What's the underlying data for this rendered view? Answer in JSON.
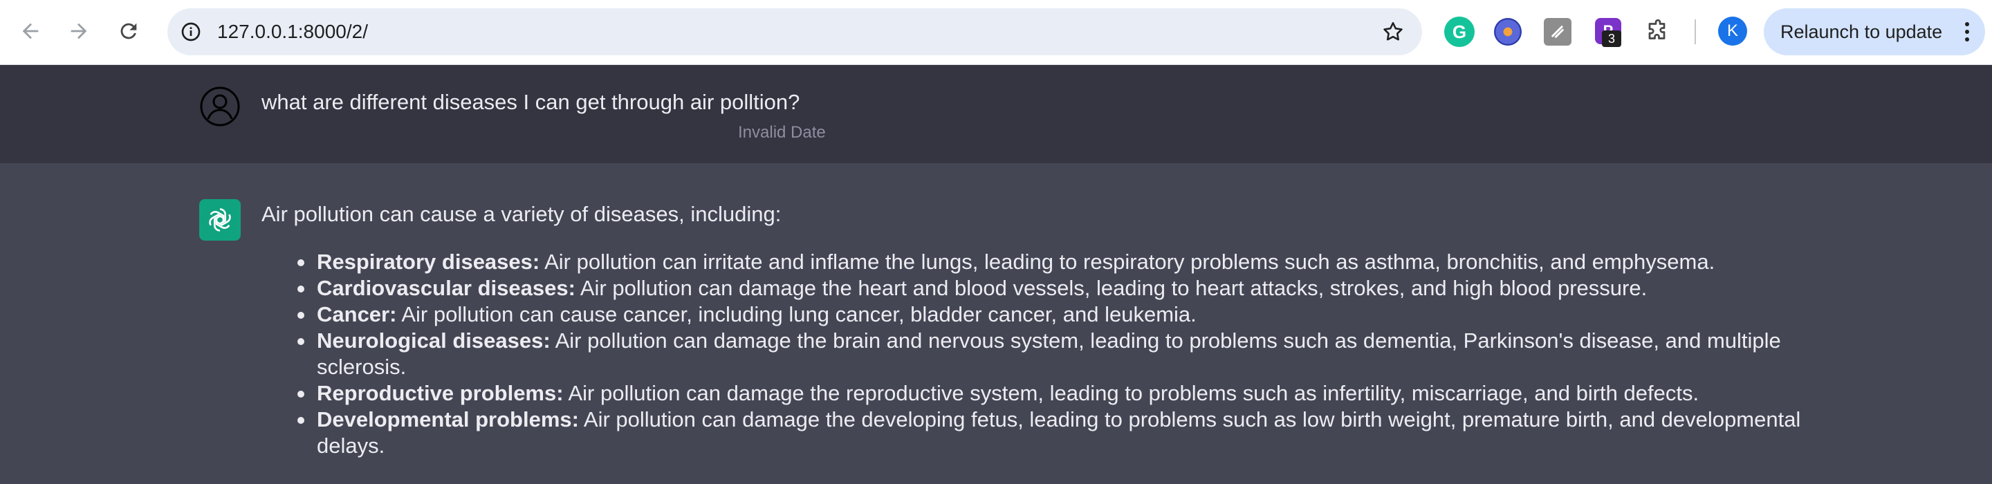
{
  "browser": {
    "url": "127.0.0.1:8000/2/",
    "profile_initial": "K",
    "relaunch_label": "Relaunch to update",
    "grammarly_letter": "G",
    "purple_ext_letter": "P",
    "purple_ext_badge": "3",
    "icons": [
      "back-arrow-icon",
      "forward-arrow-icon",
      "reload-icon",
      "info-icon",
      "star-icon",
      "puzzle-icon",
      "more-vert-icon"
    ]
  },
  "chat": {
    "user": {
      "text": "what are different diseases I can get through air polltion?",
      "date": "Invalid Date"
    },
    "bot": {
      "intro": "Air pollution can cause a variety of diseases, including:",
      "items": [
        {
          "term": "Respiratory diseases:",
          "text": " Air pollution can irritate and inflame the lungs, leading to respiratory problems such as asthma, bronchitis, and emphysema."
        },
        {
          "term": "Cardiovascular diseases:",
          "text": " Air pollution can damage the heart and blood vessels, leading to heart attacks, strokes, and high blood pressure."
        },
        {
          "term": "Cancer:",
          "text": " Air pollution can cause cancer, including lung cancer, bladder cancer, and leukemia."
        },
        {
          "term": "Neurological diseases:",
          "text": " Air pollution can damage the brain and nervous system, leading to problems such as dementia, Parkinson's disease, and multiple sclerosis."
        },
        {
          "term": "Reproductive problems:",
          "text": " Air pollution can damage the reproductive system, leading to problems such as infertility, miscarriage, and birth defects."
        },
        {
          "term": "Developmental problems:",
          "text": " Air pollution can damage the developing fetus, leading to problems such as low birth weight, premature birth, and developmental delays."
        }
      ]
    }
  },
  "colors": {
    "user_bg": "#343541",
    "bot_bg": "#444654",
    "bot_avatar": "#10a37f",
    "text": "#ececf1",
    "date": "#8e8ea0"
  }
}
